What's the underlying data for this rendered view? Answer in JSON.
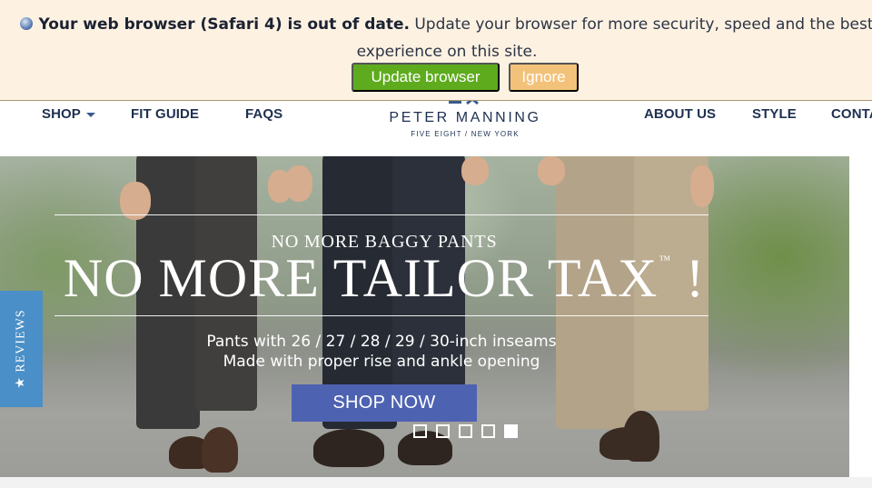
{
  "banner": {
    "bold_text": "Your web browser (Safari 4) is out of date.",
    "text": "Update your browser for more security, speed and the best experience on this site.",
    "update_label": "Update browser",
    "ignore_label": "Ignore",
    "icon": "browser-icon"
  },
  "nav": {
    "shop": "SHOP",
    "fit_guide": "FIT GUIDE",
    "faqs": "FAQS",
    "about_us": "ABOUT US",
    "style": "STYLE",
    "contact": "CONTACT"
  },
  "logo": {
    "name": "PETER MANNING",
    "tagline": "FIVE EIGHT / NEW YORK"
  },
  "hero": {
    "subtitle": "NO MORE BAGGY PANTS",
    "title": "NO MORE TAILOR TAX",
    "trademark": "™",
    "exclaim": "!",
    "line1": "Pants with 26 / 27 / 28 / 29 / 30-inch inseams",
    "line2": "Made with proper rise and ankle opening",
    "cta": "SHOP NOW",
    "slide_count": 5,
    "active_slide": 5
  },
  "reviews_tab": {
    "label": "★ REVIEWS"
  },
  "colors": {
    "nav_text": "#1e3050",
    "cta": "#4e62b2",
    "update_button": "#5eab1e",
    "ignore_button": "#f3c27a",
    "reviews_tab": "#4a8fc7",
    "banner_bg": "#fdf2e2"
  }
}
